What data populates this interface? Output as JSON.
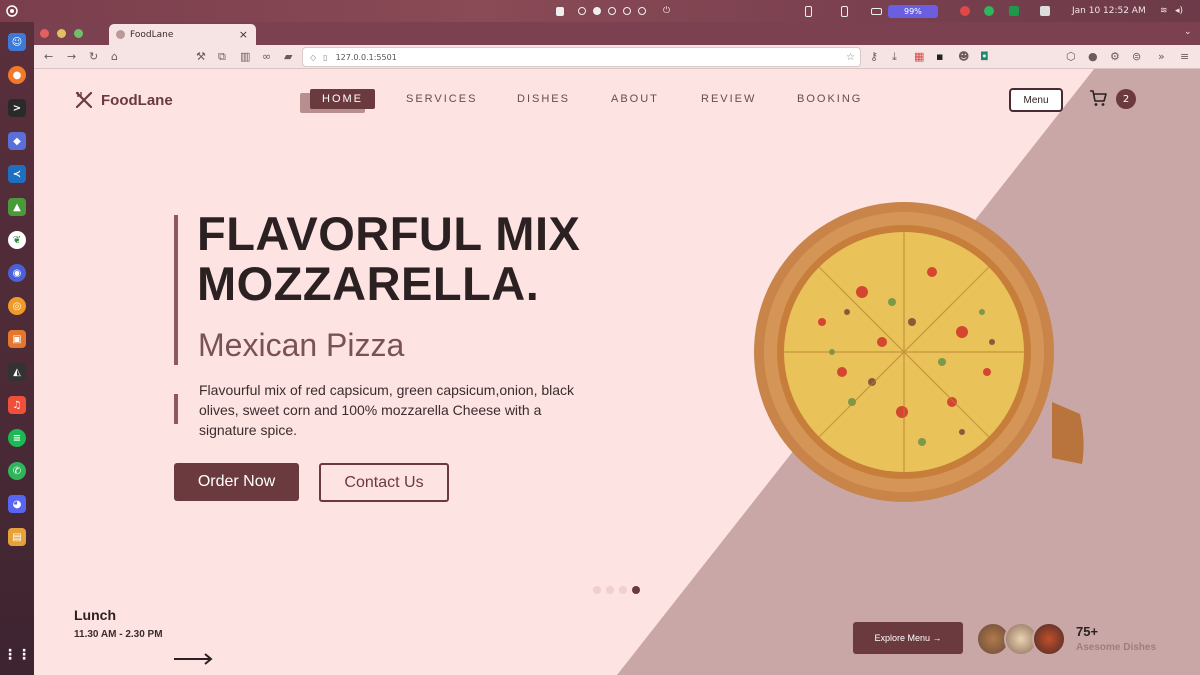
{
  "system_bar": {
    "battery": "99%",
    "date": "Jan 10",
    "time": "12:52 AM"
  },
  "browser": {
    "tab_title": "FoodLane",
    "url": "127.0.0.1:5501"
  },
  "site": {
    "logo_text": "FoodLane",
    "nav": [
      "HOME",
      "SERVICES",
      "DISHES",
      "ABOUT",
      "REVIEW",
      "BOOKING"
    ],
    "menu_button": "Menu",
    "cart_count": "2"
  },
  "hero": {
    "title_line1": "FLAVORFUL MIX",
    "title_line2": "MOZZARELLA.",
    "subtitle": "Mexican Pizza",
    "description": "Flavourful mix of red capsicum, green capsicum,onion, black olives, sweet corn and 100% mozzarella Cheese with a signature spice.",
    "order_button": "Order Now",
    "contact_button": "Contact Us",
    "active_slide": 4,
    "slide_count": 4
  },
  "footer": {
    "meal": "Lunch",
    "meal_time": "11.30 AM - 2.30 PM",
    "explore_button": "Explore Menu →",
    "dish_count": "75+",
    "dish_label": "Asesome Dishes"
  },
  "colors": {
    "primary": "#6b3a3f",
    "background": "#fde3e1",
    "diagonal": "#c9a7a6",
    "dark_text": "#2b2122"
  }
}
